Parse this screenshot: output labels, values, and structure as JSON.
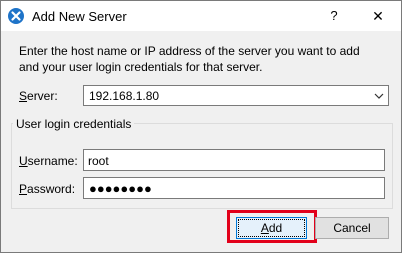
{
  "window": {
    "title": "Add New Server",
    "help_label": "?",
    "close_label": "✕",
    "icon": "app-logo-icon"
  },
  "intro": {
    "line1": "Enter the host name or IP address of the server you want to add",
    "line2": "and your user login credentials for that server."
  },
  "server": {
    "label_hotkey": "S",
    "label_rest": "erver:",
    "value": "192.168.1.80"
  },
  "credentials": {
    "group_title": "User login credentials",
    "username_label_hotkey": "U",
    "username_label_rest": "sername:",
    "username_value": "root",
    "password_label_hotkey": "P",
    "password_label_rest": "assword:",
    "password_masked": "●●●●●●●●"
  },
  "buttons": {
    "add_hotkey": "A",
    "add_rest": "dd",
    "cancel": "Cancel"
  },
  "colors": {
    "highlight": "#e2001a",
    "accent": "#0078d7"
  }
}
